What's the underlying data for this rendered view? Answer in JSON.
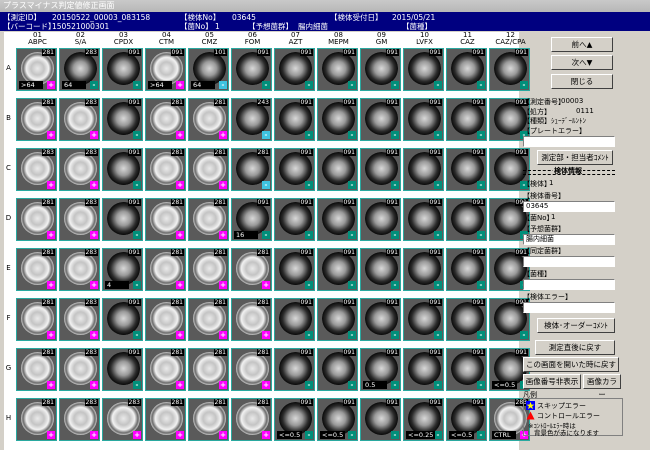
{
  "window_title": "プラスマイナス判定値修正画面",
  "info": {
    "measure_id_label": "【測定ID】",
    "measure_id_value": "20150522_00003_083158",
    "barcode_label": "【バーコード】",
    "barcode_value": "150521000301",
    "specimen_no_label": "【検体No】",
    "specimen_no_value": "03645",
    "bacteria_no_label": "【菌No】",
    "bacteria_no_value": "1",
    "expected_label": "【予想菌群】",
    "expected_value": "腸内細菌",
    "received_label": "【検体受付日】",
    "received_value": "2015/05/21",
    "species_label": "【菌種】",
    "species_value": ""
  },
  "columns": [
    {
      "num": "01",
      "drug": "ABPC"
    },
    {
      "num": "02",
      "drug": "S/A"
    },
    {
      "num": "03",
      "drug": "CPDX"
    },
    {
      "num": "04",
      "drug": "CTM"
    },
    {
      "num": "05",
      "drug": "CMZ"
    },
    {
      "num": "06",
      "drug": "FOM"
    },
    {
      "num": "07",
      "drug": "AZT"
    },
    {
      "num": "08",
      "drug": "MEPM"
    },
    {
      "num": "09",
      "drug": "GM"
    },
    {
      "num": "10",
      "drug": "LVFX"
    },
    {
      "num": "11",
      "drug": "CAZ"
    },
    {
      "num": "12",
      "drug": "CAZ/CPA"
    }
  ],
  "rows": [
    {
      "letter": "A",
      "cells": [
        {
          "n": "281",
          "m": "+",
          "v": ">64"
        },
        {
          "n": "283",
          "m": "-",
          "v": "64"
        },
        {
          "n": "091",
          "m": "-",
          "v": ""
        },
        {
          "n": "091",
          "m": "+",
          "v": ">64"
        },
        {
          "n": "101",
          "m": "cyan",
          "v": "64"
        },
        {
          "n": "091",
          "m": "-",
          "v": ""
        },
        {
          "n": "091",
          "m": "-",
          "v": ""
        },
        {
          "n": "091",
          "m": "-",
          "v": ""
        },
        {
          "n": "091",
          "m": "-",
          "v": ""
        },
        {
          "n": "091",
          "m": "-",
          "v": ""
        },
        {
          "n": "091",
          "m": "-",
          "v": ""
        },
        {
          "n": "091",
          "m": "-",
          "v": ""
        }
      ]
    },
    {
      "letter": "B",
      "cells": [
        {
          "n": "281",
          "m": "+",
          "v": ""
        },
        {
          "n": "283",
          "m": "+",
          "v": ""
        },
        {
          "n": "091",
          "m": "-",
          "v": ""
        },
        {
          "n": "281",
          "m": "+",
          "v": ""
        },
        {
          "n": "281",
          "m": "+",
          "v": ""
        },
        {
          "n": "243",
          "m": "cyan",
          "v": ""
        },
        {
          "n": "091",
          "m": "-",
          "v": ""
        },
        {
          "n": "091",
          "m": "-",
          "v": ""
        },
        {
          "n": "091",
          "m": "-",
          "v": ""
        },
        {
          "n": "091",
          "m": "-",
          "v": ""
        },
        {
          "n": "091",
          "m": "-",
          "v": ""
        },
        {
          "n": "091",
          "m": "-",
          "v": ""
        }
      ]
    },
    {
      "letter": "C",
      "cells": [
        {
          "n": "283",
          "m": "+",
          "v": ""
        },
        {
          "n": "283",
          "m": "+",
          "v": ""
        },
        {
          "n": "091",
          "m": "-",
          "v": ""
        },
        {
          "n": "281",
          "m": "+",
          "v": ""
        },
        {
          "n": "281",
          "m": "+",
          "v": ""
        },
        {
          "n": "281",
          "m": "cyan",
          "v": ""
        },
        {
          "n": "091",
          "m": "-",
          "v": ""
        },
        {
          "n": "091",
          "m": "-",
          "v": ""
        },
        {
          "n": "091",
          "m": "-",
          "v": ""
        },
        {
          "n": "091",
          "m": "-",
          "v": ""
        },
        {
          "n": "091",
          "m": "-",
          "v": ""
        },
        {
          "n": "091",
          "m": "-",
          "v": ""
        }
      ]
    },
    {
      "letter": "D",
      "cells": [
        {
          "n": "281",
          "m": "+",
          "v": ""
        },
        {
          "n": "283",
          "m": "+",
          "v": ""
        },
        {
          "n": "091",
          "m": "-",
          "v": ""
        },
        {
          "n": "281",
          "m": "+",
          "v": ""
        },
        {
          "n": "281",
          "m": "+",
          "v": ""
        },
        {
          "n": "091",
          "m": "-",
          "v": "16"
        },
        {
          "n": "091",
          "m": "-",
          "v": ""
        },
        {
          "n": "091",
          "m": "-",
          "v": ""
        },
        {
          "n": "091",
          "m": "-",
          "v": ""
        },
        {
          "n": "091",
          "m": "-",
          "v": ""
        },
        {
          "n": "091",
          "m": "-",
          "v": ""
        },
        {
          "n": "091",
          "m": "-",
          "v": ""
        }
      ]
    },
    {
      "letter": "E",
      "cells": [
        {
          "n": "281",
          "m": "+",
          "v": ""
        },
        {
          "n": "283",
          "m": "+",
          "v": ""
        },
        {
          "n": "091",
          "m": "-",
          "v": "4"
        },
        {
          "n": "281",
          "m": "+",
          "v": ""
        },
        {
          "n": "281",
          "m": "+",
          "v": ""
        },
        {
          "n": "281",
          "m": "+",
          "v": ""
        },
        {
          "n": "091",
          "m": "-",
          "v": ""
        },
        {
          "n": "091",
          "m": "-",
          "v": ""
        },
        {
          "n": "091",
          "m": "-",
          "v": ""
        },
        {
          "n": "091",
          "m": "-",
          "v": ""
        },
        {
          "n": "091",
          "m": "-",
          "v": ""
        },
        {
          "n": "091",
          "m": "-",
          "v": ""
        }
      ]
    },
    {
      "letter": "F",
      "cells": [
        {
          "n": "281",
          "m": "+",
          "v": ""
        },
        {
          "n": "283",
          "m": "+",
          "v": ""
        },
        {
          "n": "091",
          "m": "-",
          "v": ""
        },
        {
          "n": "281",
          "m": "+",
          "v": ""
        },
        {
          "n": "281",
          "m": "+",
          "v": ""
        },
        {
          "n": "281",
          "m": "+",
          "v": ""
        },
        {
          "n": "091",
          "m": "-",
          "v": ""
        },
        {
          "n": "091",
          "m": "-",
          "v": ""
        },
        {
          "n": "091",
          "m": "-",
          "v": ""
        },
        {
          "n": "091",
          "m": "-",
          "v": ""
        },
        {
          "n": "091",
          "m": "-",
          "v": ""
        },
        {
          "n": "091",
          "m": "-",
          "v": ""
        }
      ]
    },
    {
      "letter": "G",
      "cells": [
        {
          "n": "281",
          "m": "+",
          "v": ""
        },
        {
          "n": "283",
          "m": "+",
          "v": ""
        },
        {
          "n": "091",
          "m": "-",
          "v": ""
        },
        {
          "n": "281",
          "m": "+",
          "v": ""
        },
        {
          "n": "281",
          "m": "+",
          "v": ""
        },
        {
          "n": "281",
          "m": "+",
          "v": ""
        },
        {
          "n": "091",
          "m": "-",
          "v": ""
        },
        {
          "n": "091",
          "m": "-",
          "v": ""
        },
        {
          "n": "091",
          "m": "-",
          "v": "0.5"
        },
        {
          "n": "091",
          "m": "-",
          "v": ""
        },
        {
          "n": "091",
          "m": "-",
          "v": ""
        },
        {
          "n": "091",
          "m": "-",
          "v": "<=0.5"
        }
      ]
    },
    {
      "letter": "H",
      "cells": [
        {
          "n": "281",
          "m": "+",
          "v": ""
        },
        {
          "n": "283",
          "m": "+",
          "v": ""
        },
        {
          "n": "283",
          "m": "+",
          "v": ""
        },
        {
          "n": "281",
          "m": "+",
          "v": ""
        },
        {
          "n": "281",
          "m": "+",
          "v": ""
        },
        {
          "n": "281",
          "m": "+",
          "v": ""
        },
        {
          "n": "091",
          "m": "-",
          "v": "<=0.5"
        },
        {
          "n": "091",
          "m": "-",
          "v": "<=0.5"
        },
        {
          "n": "091",
          "m": "-",
          "v": ""
        },
        {
          "n": "091",
          "m": "-",
          "v": "<=0.25"
        },
        {
          "n": "091",
          "m": "-",
          "v": "<=0.5"
        },
        {
          "n": "283",
          "m": "+",
          "v": "CTRL"
        }
      ]
    }
  ],
  "sidebar": {
    "prev_button": "前へ▲",
    "next_button": "次へ▼",
    "close_button": "閉じる",
    "measure_no_label": "【測定番号】",
    "measure_no_value": "00003",
    "facility_label": "【処方】",
    "facility_value": "0111",
    "panel_label": "【種類】",
    "panel_value": "ｼｭｰﾃﾞｰﾙﾝﾄﾝ",
    "plate_error_label": "【プレートエラー】",
    "plate_error_value": "",
    "comment_button": "測定部・担当者ｺﾒﾝﾄ",
    "section_title": "検体情報",
    "spec_label": "【検体】",
    "spec_value": "1",
    "spec_no_label": "【検体番号】",
    "spec_no_value": "03645",
    "bac_no_label": "【菌No】",
    "bac_no_value": "1",
    "expect_label": "【予想菌群】",
    "expect_value": "腸内細菌",
    "judge_label": "【同定菌群】",
    "judge_value": "",
    "species_label": "【菌種】",
    "species_value": "",
    "spec_error_label": "【検体エラー】",
    "spec_error_value": "",
    "spec_order_button": "検体･オーダーｺﾒﾝﾄ",
    "return_button": "測定直後に戻す",
    "return_open_button": "この画面を開いた時に戻す",
    "image_no_button": "画像番号非表示",
    "image_color_button": "画像カラー",
    "legend_title": "凡例",
    "legend_skip": "スキップエラー",
    "legend_control": "コントロールエラー",
    "legend_note1": "※ｺﾝﾄﾛｰﾙｴﾗｰ時は",
    "legend_note2": "背景色が赤になります",
    "colors": {
      "plus": "#ff00ff",
      "minus": "#008f7a",
      "header": "#000080"
    }
  }
}
